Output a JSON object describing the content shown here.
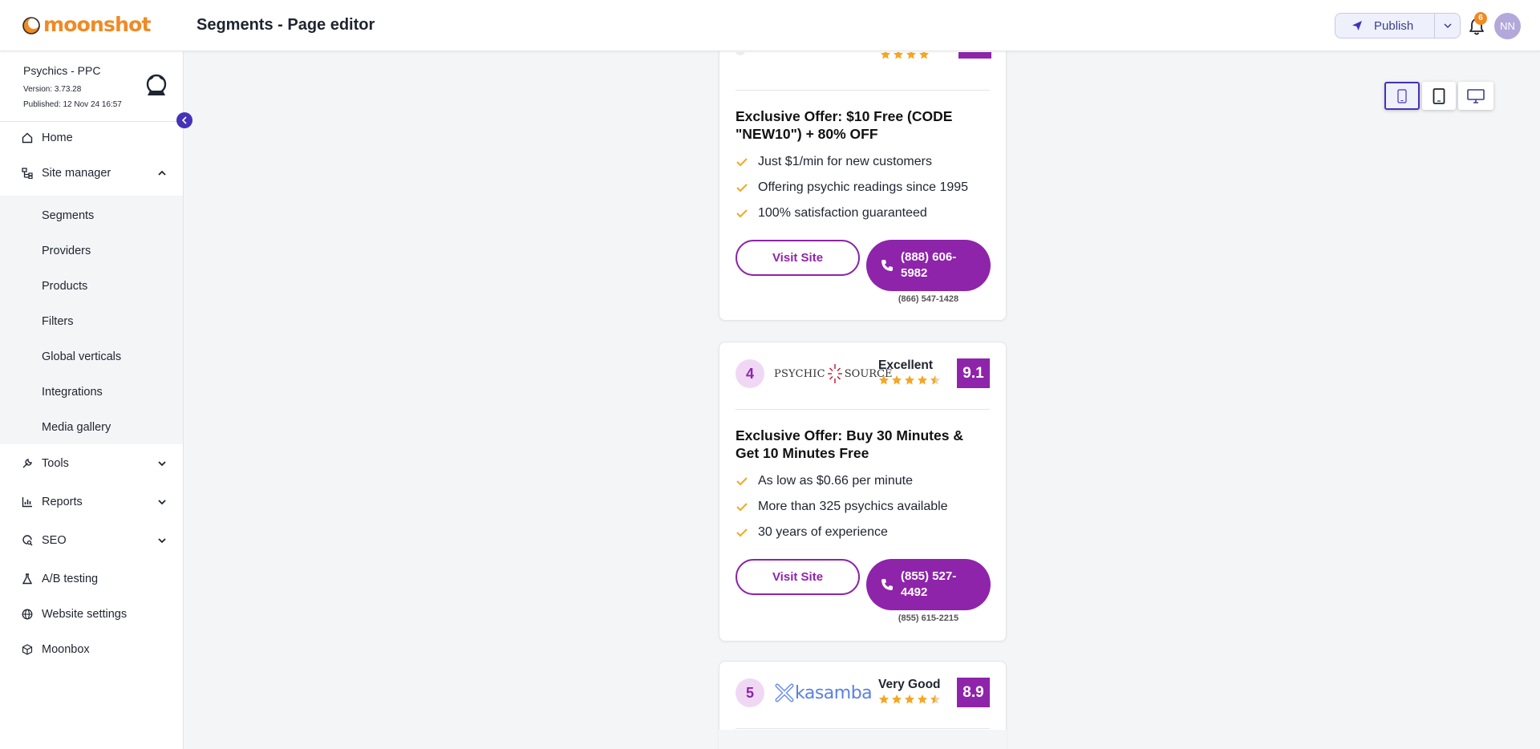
{
  "app": {
    "brand": "moonshot",
    "page_title": "Segments - Page editor",
    "publish_label": "Publish",
    "notification_count": "6",
    "user_initials": "NN"
  },
  "site": {
    "name": "Psychics - PPC",
    "version": "Version: 3.73.28",
    "published": "Published: 12 Nov 24 16:57"
  },
  "nav": {
    "home": "Home",
    "site_manager": "Site manager",
    "sub": {
      "segments": "Segments",
      "providers": "Providers",
      "products": "Products",
      "filters": "Filters",
      "global_verticals": "Global verticals",
      "integrations": "Integrations",
      "media_gallery": "Media gallery"
    },
    "tools": "Tools",
    "reports": "Reports",
    "seo": "SEO",
    "ab_testing": "A/B testing",
    "website_settings": "Website settings",
    "moonbox": "Moonbox"
  },
  "device_view": {
    "active": "mobile"
  },
  "cards": [
    {
      "offer": "Exclusive Offer: $10 Free (CODE \"NEW10\") + 80% OFF",
      "features": [
        "Just $1/min for new customers",
        "Offering psychic readings since 1995",
        "100% satisfaction guaranteed"
      ],
      "visit_label": "Visit Site",
      "phone": "(888) 606-5982",
      "alt_phone": "(866) 547-1428"
    },
    {
      "rank": "4",
      "brand": "PSYCHIC SOURCE",
      "brand_logo_text": {
        "left": "PSYCHIC",
        "right": "SOURCE"
      },
      "rating_word": "Excellent",
      "stars": 4.5,
      "score": "9.1",
      "offer": "Exclusive Offer: Buy 30 Minutes & Get 10 Minutes Free",
      "features": [
        "As low as $0.66 per minute",
        "More than 325 psychics available",
        "30 years of experience"
      ],
      "visit_label": "Visit Site",
      "phone": "(855) 527-4492",
      "alt_phone": "(855) 615-2215"
    },
    {
      "rank": "5",
      "brand": "kasamba",
      "rating_word": "Very Good",
      "stars": 4.5,
      "score": "8.9"
    }
  ],
  "colors": {
    "accent_purple": "#8e24aa",
    "nav_accent": "#4433b8",
    "brand_orange": "#f08a24",
    "star": "#f5a623",
    "check": "#f5a623"
  }
}
